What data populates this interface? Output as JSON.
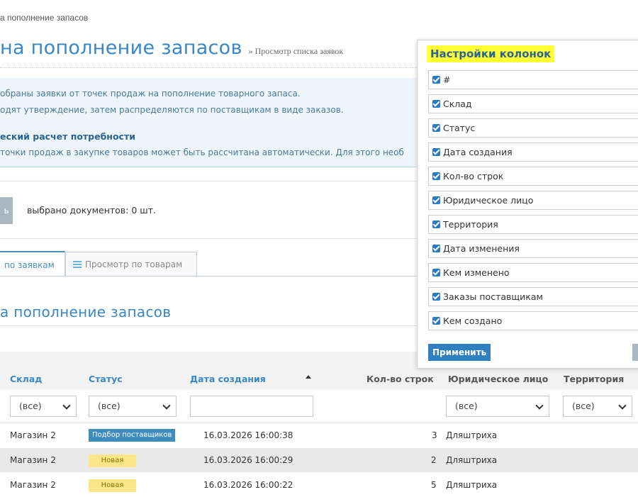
{
  "breadcrumb": "а пополнение запасов",
  "page": {
    "title": "на пополнение запасов",
    "subtitle": "» Просмотр списка заявок"
  },
  "info": {
    "line1": "обраны заявки от точек продаж на пополнение товарного запаса.",
    "line2": "одят утверждение, затем распределяются по поставщикам в виде заказов.",
    "heading": "еский расчет потребности",
    "line3": "точки продаж в закупке товаров может быть рассчитана автоматически. Для этого необ"
  },
  "toolbar": {
    "button_label": "ь",
    "selected_text": "выбрано документов: 0 шт."
  },
  "tabs": [
    {
      "label": "по заявкам",
      "active": true
    },
    {
      "label": "Просмотр по товарам",
      "icon": "list-icon",
      "active": false
    }
  ],
  "section_title": "а пополнение запасов",
  "table": {
    "columns": [
      "Склад",
      "Статус",
      "Дата создания",
      "Кол-во строк",
      "Юридическое лицо",
      "Территория"
    ],
    "filters": {
      "all": "(все)"
    },
    "rows": [
      {
        "warehouse": "Магазин 2",
        "status": "Подбор поставщиков",
        "status_style": "blue",
        "created": "16.03.2026 16:00:38",
        "lines": "3",
        "legal_entity": "Дляштриха"
      },
      {
        "warehouse": "Магазин 2",
        "status": "Новая",
        "status_style": "yellow",
        "created": "16.03.2026 16:00:29",
        "lines": "2",
        "legal_entity": "Дляштриха"
      },
      {
        "warehouse": "Магазин 2",
        "status": "Новая",
        "status_style": "yellow",
        "created": "16.03.2026 16:00:22",
        "lines": "5",
        "legal_entity": "Дляштриха"
      }
    ]
  },
  "column_settings": {
    "title": "Настройки колонок",
    "items": [
      "#",
      "Склад",
      "Статус",
      "Дата создания",
      "Кол-во строк",
      "Юридическое лицо",
      "Территория",
      "Дата изменения",
      "Кем изменено",
      "Заказы поставщикам",
      "Кем создано"
    ],
    "apply_label": "Применить"
  },
  "colors": {
    "accent": "#3a87c5",
    "badge_blue": "#3f8dbf",
    "badge_yellow": "#fde58a",
    "highlight": "#ffff33"
  }
}
